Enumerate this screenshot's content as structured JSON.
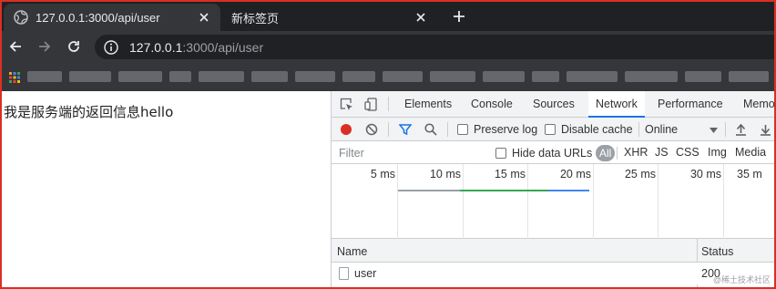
{
  "browser": {
    "tabs": [
      {
        "title": "127.0.0.1:3000/api/user",
        "active": true
      },
      {
        "title": "新标签页",
        "active": false
      }
    ],
    "address": {
      "host": "127.0.0.1",
      "rest": ":3000/api/user"
    }
  },
  "page": {
    "text": "我是服务端的返回信息hello"
  },
  "devtools": {
    "panels": [
      "Elements",
      "Console",
      "Sources",
      "Network",
      "Performance",
      "Memo"
    ],
    "active_panel": "Network",
    "network_toolbar": {
      "preserve_log": "Preserve log",
      "disable_cache": "Disable cache",
      "throttling": "Online"
    },
    "filter_bar": {
      "filter_placeholder": "Filter",
      "hide_data_urls": "Hide data URLs",
      "types": [
        "All",
        "XHR",
        "JS",
        "CSS",
        "Img",
        "Media"
      ]
    },
    "timeline": {
      "ticks": [
        "5 ms",
        "10 ms",
        "15 ms",
        "20 ms",
        "25 ms",
        "30 ms",
        "35 m"
      ]
    },
    "table": {
      "columns": [
        "Name",
        "Status"
      ],
      "rows": [
        {
          "name": "user",
          "status": "200"
        }
      ]
    }
  },
  "colors": {
    "accent": "#1a73e8",
    "record": "#d93025",
    "frame": "#d93025"
  },
  "watermark": "@稀土技术社区"
}
